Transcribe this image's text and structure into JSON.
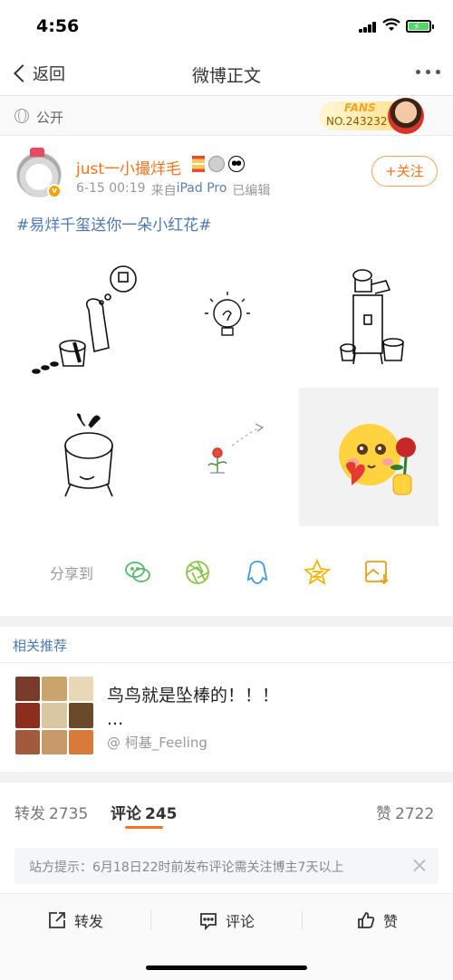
{
  "status_bar": {
    "time": "4:56"
  },
  "nav": {
    "back_label": "返回",
    "title": "微博正文",
    "more_icon": "more-icon"
  },
  "visibility": {
    "label": "公开",
    "icon": "globe-icon"
  },
  "fans_badge": {
    "word": "FANS",
    "number": "NO.243232"
  },
  "post": {
    "username": "just一小撮烊毛",
    "date": "6-15 00:19",
    "source_prefix": "来自",
    "source": "iPad Pro",
    "edited": "已编辑",
    "follow_label": "+关注",
    "hashtag": "#易烊千玺送你一朵小红花#",
    "accent_color": "#f7731c",
    "link_color": "#4c79b3"
  },
  "share": {
    "label": "分享到",
    "targets": [
      "wechat-icon",
      "moments-icon",
      "qq-icon",
      "qzone-icon",
      "save-image-icon"
    ]
  },
  "recommend": {
    "header": "相关推荐",
    "title": "鸟鸟就是坠棒的！！！",
    "ellipsis": "...",
    "author": "@ 柯基_Feeling"
  },
  "tabs": {
    "repost_label": "转发",
    "repost_count": "2735",
    "comment_label": "评论",
    "comment_count": "245",
    "like_label": "赞",
    "like_count": "2722"
  },
  "notice": {
    "text": "站方提示：6月18日22时前发布评论需关注博主7天以上"
  },
  "bottom_bar": {
    "repost": "转发",
    "comment": "评论",
    "like": "赞"
  }
}
